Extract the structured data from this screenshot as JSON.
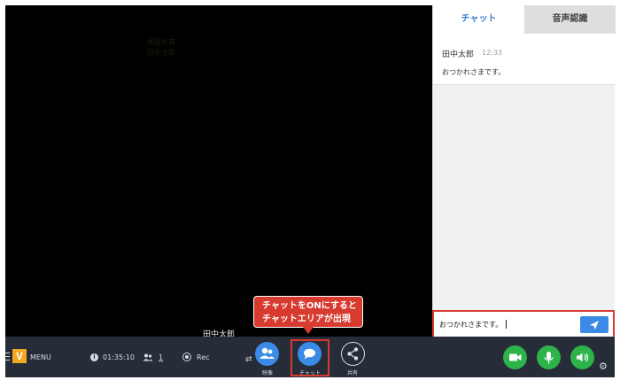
{
  "video": {
    "faint_text": "画面共有\n田中太郎",
    "participant_name": "田中太郎"
  },
  "callout": {
    "line1": "チャットをONにすると",
    "line2": "チャットエリアが出現"
  },
  "chat": {
    "tabs": [
      {
        "label": "チャット",
        "active": true
      },
      {
        "label": "音声認識",
        "active": false
      }
    ],
    "messages": [
      {
        "sender": "田中太郎",
        "time": "12:33",
        "text": "おつかれさまです。"
      }
    ],
    "input_value": "おつかれさまです。"
  },
  "toolbar": {
    "logo": "V",
    "menu_label": "MENU",
    "elapsed_time": "01:35:10",
    "participant_count": "1",
    "rec_label": "Rec",
    "buttons": [
      {
        "caption": "映像",
        "icon": "people-icon"
      },
      {
        "caption": "チャット",
        "icon": "speech-bubble-icon"
      },
      {
        "caption": "共有",
        "icon": "share-icon"
      }
    ]
  },
  "colors": {
    "accent_blue": "#3b8ae6",
    "highlight_red": "#d73a2f",
    "toolbar_bg": "#262d38",
    "green": "#2db34a"
  }
}
